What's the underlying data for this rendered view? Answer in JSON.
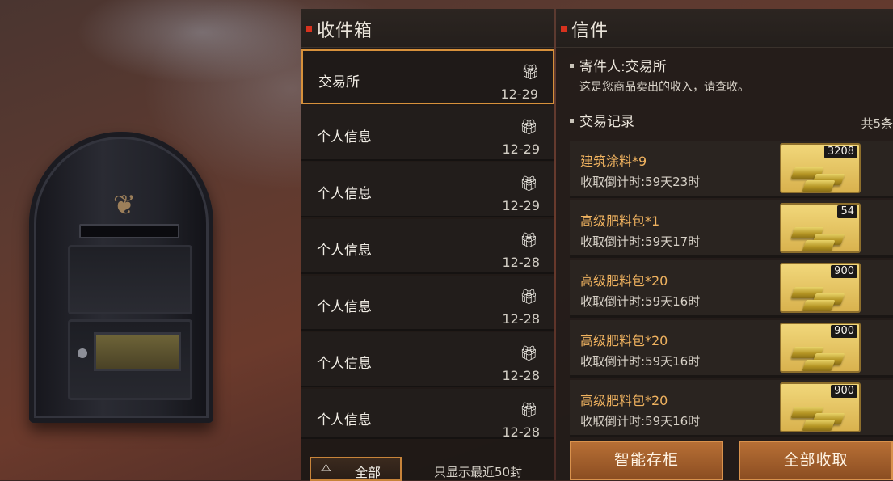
{
  "colors": {
    "accent_orange": "#d7913b",
    "item_name": "#efb25f",
    "header_dot": "#d8321e",
    "button": "#b76f35"
  },
  "inbox": {
    "title": "收件箱",
    "items": [
      {
        "subject": "交易所",
        "date": "12-29",
        "icon": "gift-icon",
        "selected": true
      },
      {
        "subject": "个人信息",
        "date": "12-29",
        "icon": "gift-icon"
      },
      {
        "subject": "个人信息",
        "date": "12-29",
        "icon": "gift-icon"
      },
      {
        "subject": "个人信息",
        "date": "12-28",
        "icon": "gift-icon"
      },
      {
        "subject": "个人信息",
        "date": "12-28",
        "icon": "gift-icon"
      },
      {
        "subject": "个人信息",
        "date": "12-28",
        "icon": "gift-icon"
      },
      {
        "subject": "个人信息",
        "date": "12-28",
        "icon": "gift-icon"
      }
    ],
    "filter_button": "全部",
    "footer_note": "只显示最近50封"
  },
  "mail": {
    "title": "信件",
    "sender": "寄件人:交易所",
    "body": "这是您商品卖出的收入，请查收。",
    "records_label": "交易记录",
    "records_count": "共5条",
    "records": [
      {
        "item": "建筑涂料*9",
        "countdown": "收取倒计时:59天23时",
        "quantity": "3208",
        "icon": "gold-bars-icon"
      },
      {
        "item": "高级肥料包*1",
        "countdown": "收取倒计时:59天17时",
        "quantity": "54",
        "icon": "gold-bars-icon"
      },
      {
        "item": "高级肥料包*20",
        "countdown": "收取倒计时:59天16时",
        "quantity": "900",
        "icon": "gold-bars-icon"
      },
      {
        "item": "高级肥料包*20",
        "countdown": "收取倒计时:59天16时",
        "quantity": "900",
        "icon": "gold-bars-icon"
      },
      {
        "item": "高级肥料包*20",
        "countdown": "收取倒计时:59天16时",
        "quantity": "900",
        "icon": "gold-bars-icon"
      }
    ],
    "smart_store_button": "智能存柜",
    "collect_all_button": "全部收取"
  }
}
